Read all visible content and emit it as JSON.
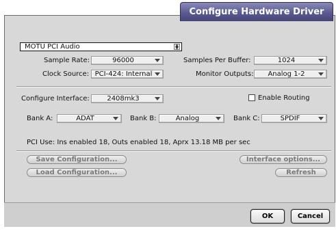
{
  "window": {
    "title": "Configure Hardware Driver"
  },
  "device": {
    "selected": "MOTU PCI Audio"
  },
  "sample_rate": {
    "label": "Sample Rate:",
    "value": "96000"
  },
  "samples_per_buffer": {
    "label": "Samples Per Buffer:",
    "value": "1024"
  },
  "clock_source": {
    "label": "Clock Source:",
    "value": "PCI-424: Internal"
  },
  "monitor_outputs": {
    "label": "Monitor Outputs:",
    "value": "Analog 1-2"
  },
  "configure_interface": {
    "label": "Configure Interface:",
    "value": "2408mk3"
  },
  "enable_routing": {
    "label": "Enable Routing",
    "checked": false
  },
  "bank_a": {
    "label": "Bank A:",
    "value": "ADAT"
  },
  "bank_b": {
    "label": "Bank B:",
    "value": "Analog"
  },
  "bank_c": {
    "label": "Bank C:",
    "value": "SPDIF"
  },
  "pci_use": {
    "text": "PCI Use: Ins enabled 18, Outs enabled 18, Aprx 13.18 MB per sec"
  },
  "buttons": {
    "save_configuration": "Save Configuration...",
    "load_configuration": "Load Configuration...",
    "interface_options": "Interface options...",
    "refresh": "Refresh",
    "ok": "OK",
    "cancel": "Cancel"
  }
}
